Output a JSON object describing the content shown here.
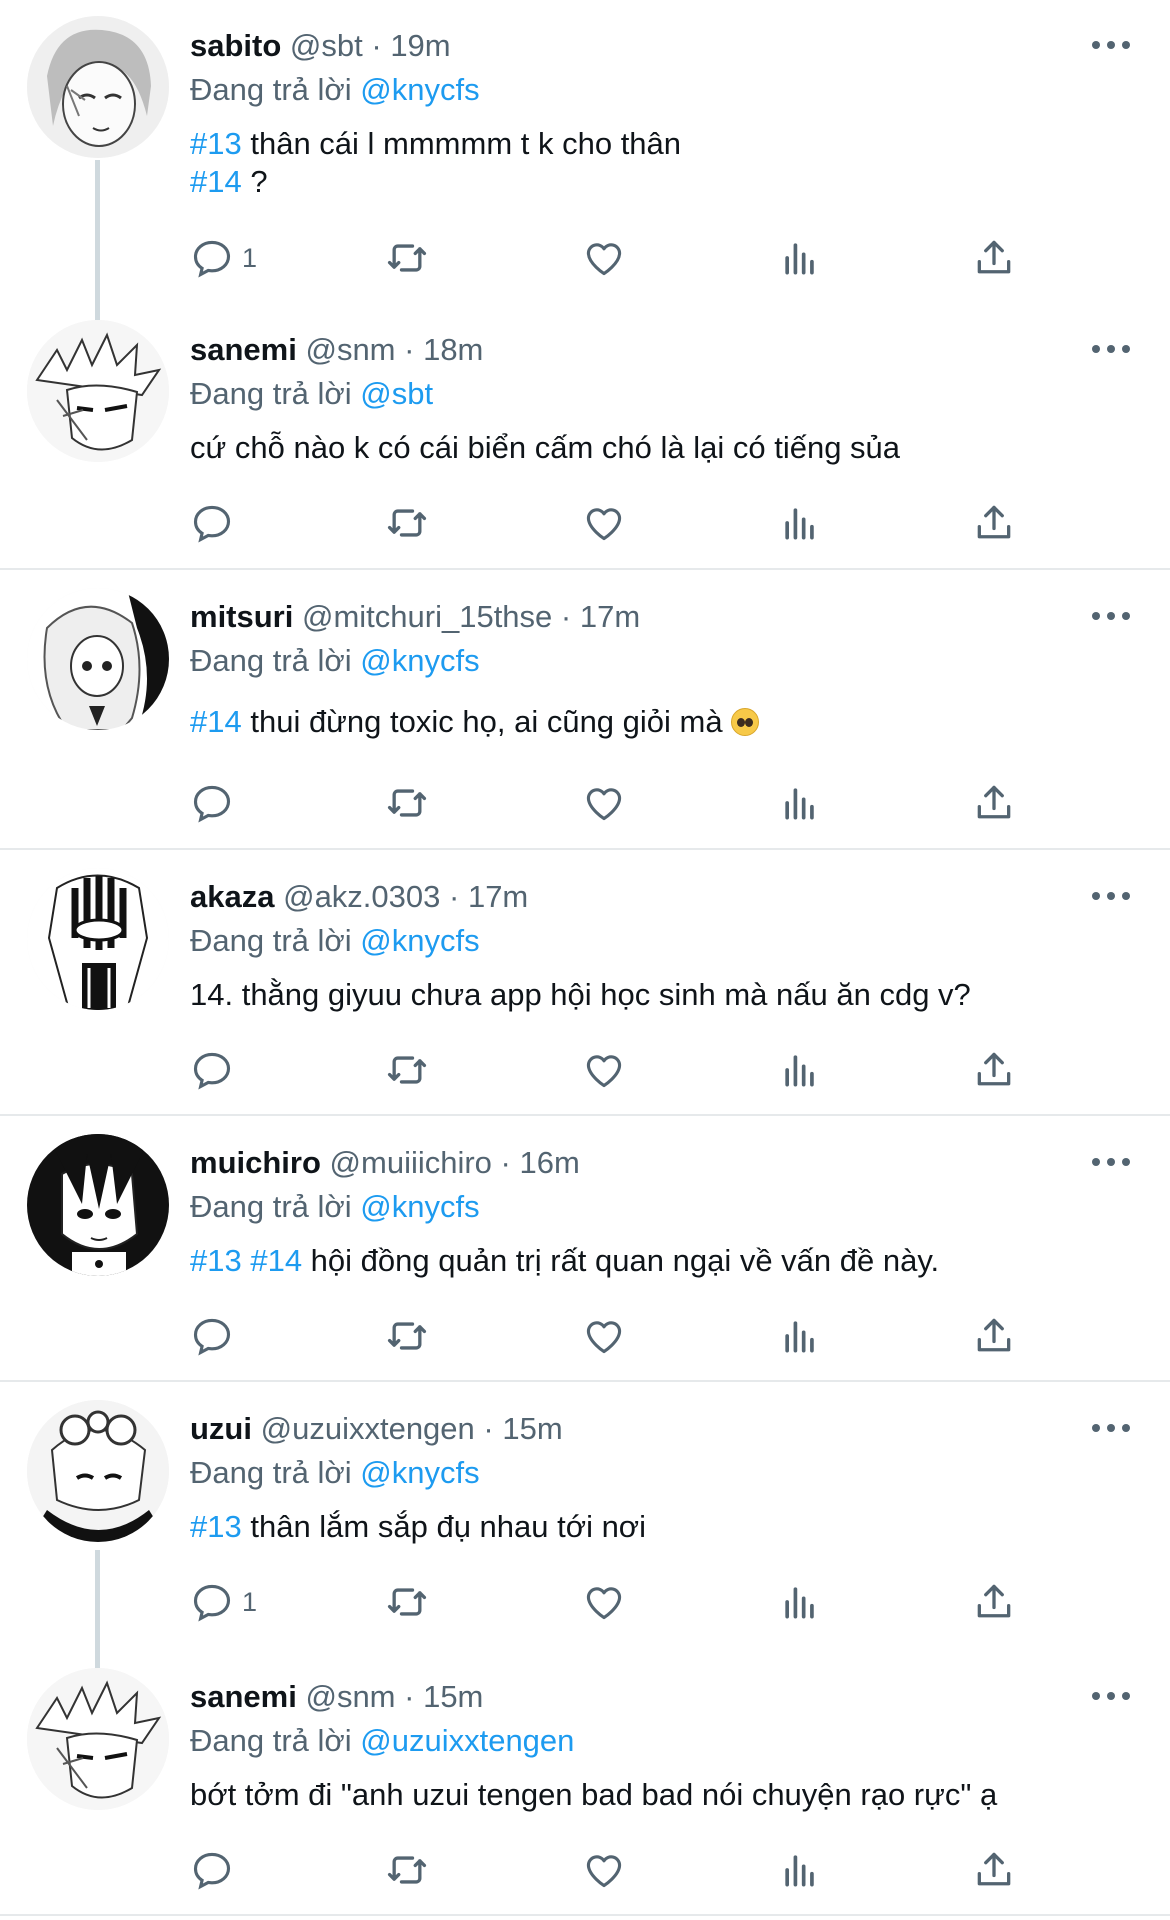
{
  "reply_prefix": "Đang trả lời",
  "tweets": [
    {
      "name": "sabito",
      "handle": "@sbt",
      "time": "19m",
      "reply_to": "@knycfs",
      "lines": [
        {
          "tag": "#13",
          "text": " thân cái l mmmmm t k cho thân"
        },
        {
          "tag": "#14",
          "text": " ?"
        }
      ],
      "reply_count": "1"
    },
    {
      "name": "sanemi",
      "handle": "@snm",
      "time": "18m",
      "reply_to": "@sbt",
      "lines": [
        {
          "tag": "",
          "text": "cứ chỗ nào k có cái biển cấm chó là lại có tiếng sủa"
        }
      ],
      "reply_count": ""
    },
    {
      "name": "mitsuri",
      "handle": "@mitchuri_15thse",
      "time": "17m",
      "reply_to": "@knycfs",
      "lines": [
        {
          "tag": "#14",
          "text": " thui đừng toxic họ, ai cũng giỏi mà "
        }
      ],
      "emoji": "pleading-face-emoji",
      "reply_count": ""
    },
    {
      "name": "akaza",
      "handle": "@akz.0303",
      "time": "17m",
      "reply_to": "@knycfs",
      "lines": [
        {
          "tag": "",
          "text": "14. thằng giyuu chưa app hội học sinh mà nấu ăn cdg v?"
        }
      ],
      "reply_count": ""
    },
    {
      "name": "muichiro",
      "handle": "@muiiichiro",
      "time": "16m",
      "reply_to": "@knycfs",
      "lines": [
        {
          "tag": "#13 #14",
          "text": " hội đồng quản trị rất quan ngại về vấn đề này."
        }
      ],
      "reply_count": ""
    },
    {
      "name": "uzui",
      "handle": "@uzuixxtengen",
      "time": "15m",
      "reply_to": "@knycfs",
      "lines": [
        {
          "tag": "#13",
          "text": " thân lắm sắp đụ nhau tới nơi"
        }
      ],
      "reply_count": "1"
    },
    {
      "name": "sanemi",
      "handle": "@snm",
      "time": "15m",
      "reply_to": "@uzuixxtengen",
      "lines": [
        {
          "tag": "",
          "text": "bớt tởm đi \"anh uzui tengen bad bad nói chuyện rạo rực\" ạ"
        }
      ],
      "reply_count": ""
    }
  ],
  "colors": {
    "link": "#1d9bf0",
    "muted": "#536471",
    "divider": "#e6e9eb",
    "thread": "#cfd9de"
  },
  "icons": [
    "reply-icon",
    "retweet-icon",
    "like-icon",
    "views-icon",
    "share-icon",
    "more-icon"
  ]
}
